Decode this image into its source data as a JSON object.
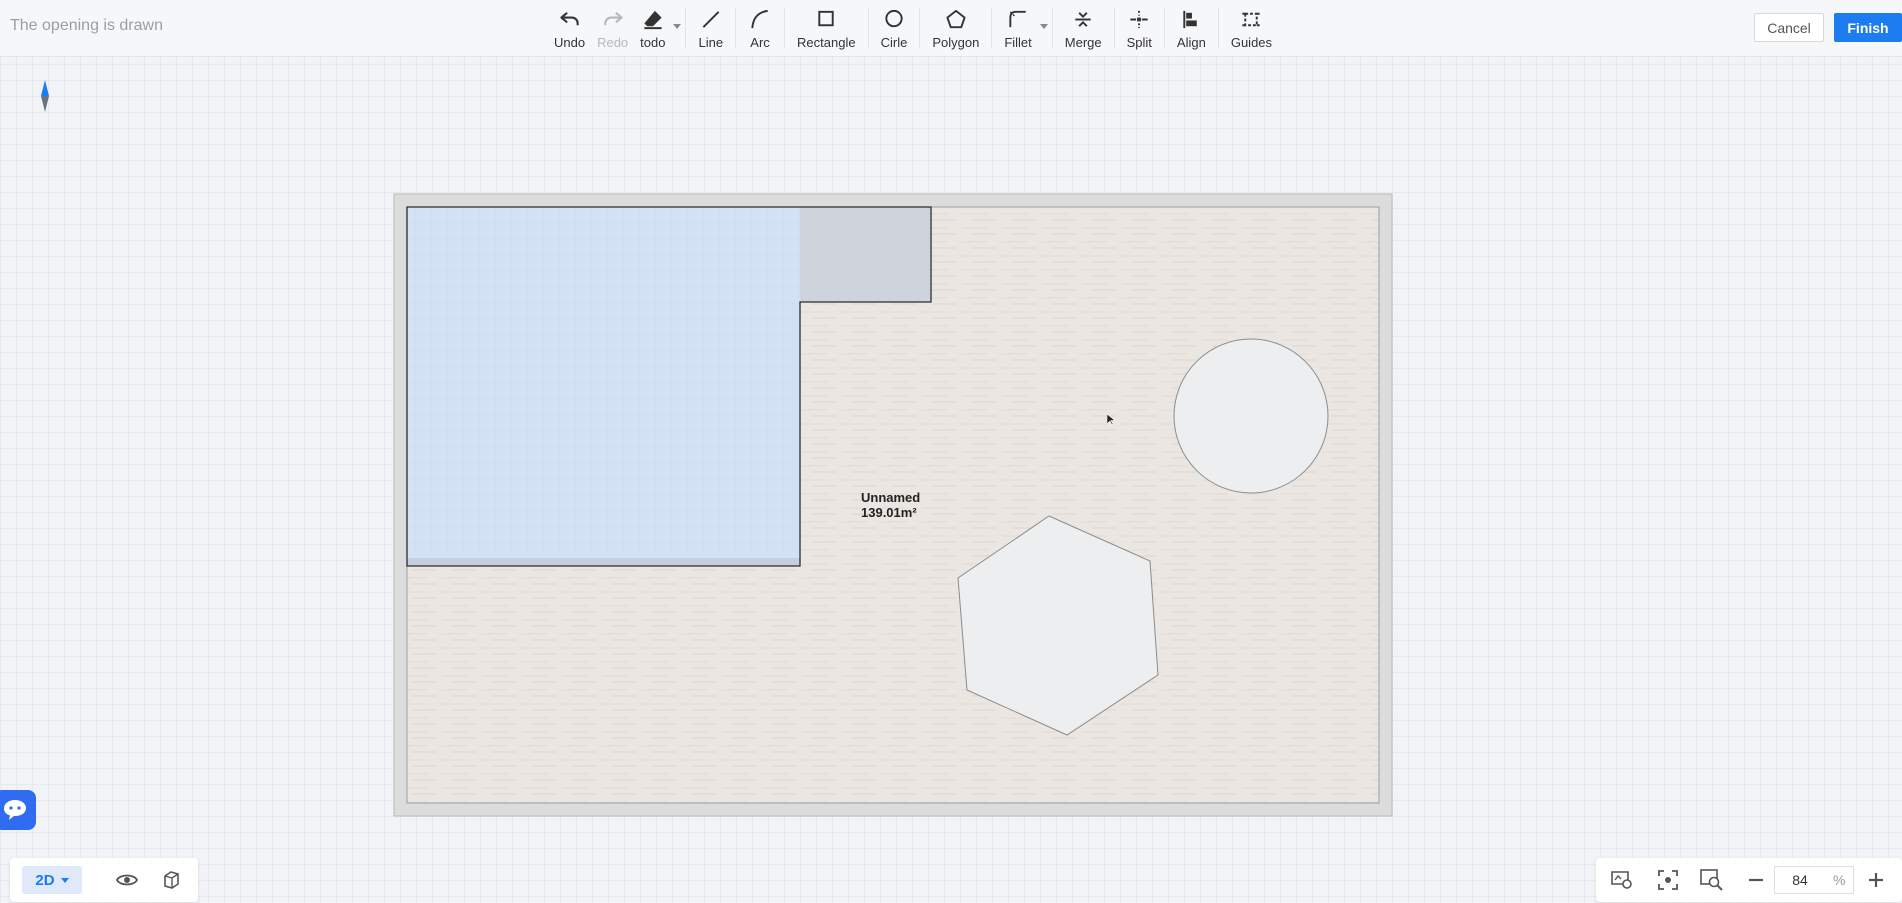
{
  "header": {
    "title": "The opening is drawn",
    "cancel_label": "Cancel",
    "finish_label": "Finish"
  },
  "toolbar": {
    "undo": "Undo",
    "redo": "Redo",
    "todo": "todo",
    "line": "Line",
    "arc": "Arc",
    "rectangle": "Rectangle",
    "circle": "Cirle",
    "polygon": "Polygon",
    "fillet": "Fillet",
    "merge": "Merge",
    "split": "Split",
    "align": "Align",
    "guides": "Guides"
  },
  "room": {
    "name": "Unnamed",
    "area": "139.01m²"
  },
  "view": {
    "mode": "2D"
  },
  "zoom": {
    "value": "84",
    "unit": "%"
  },
  "colors": {
    "accent": "#1d7cf0",
    "floor": "#ebe6e2",
    "selected_region": "#d3e1f4"
  }
}
